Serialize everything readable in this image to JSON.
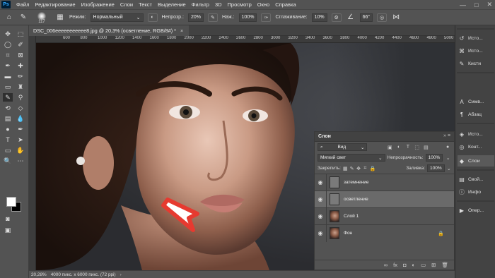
{
  "app": {
    "logo": "Ps"
  },
  "menu": [
    "Файл",
    "Редактирование",
    "Изображение",
    "Слои",
    "Текст",
    "Выделение",
    "Фильтр",
    "3D",
    "Просмотр",
    "Окно",
    "Справка"
  ],
  "window_controls": {
    "minimize": "—",
    "restore": "□",
    "close": "✕"
  },
  "options": {
    "brush_size": "117",
    "mode_label": "Режим:",
    "mode_value": "Нормальный",
    "opacity_label": "Непрозр.:",
    "opacity_value": "20%",
    "pressure_label": "Наж.:",
    "pressure_value": "100%",
    "smoothing_label": "Сглаживание:",
    "smoothing_value": "10%",
    "angle_value": "66°"
  },
  "document": {
    "tab_title": "DSC_006eeeeeeeeeee8.jpg @ 20,3% (осветление, RGB/8#) *",
    "close": "×",
    "ruler_ticks": [
      "600",
      "800",
      "1000",
      "1200",
      "1400",
      "1600",
      "1800",
      "2000",
      "2200",
      "2400",
      "2600",
      "2800",
      "3000",
      "3200",
      "3400",
      "3600",
      "3800",
      "4000",
      "4200",
      "4400",
      "4600",
      "4800",
      "5000",
      "5200"
    ]
  },
  "status": {
    "zoom": "20,28%",
    "info": "4000 пикс. x 6000 пикс. (72 ppi)",
    "arrow": "›"
  },
  "layers_panel": {
    "title": "Слои",
    "filter_kind": "Вид",
    "blend_mode": "Мягкий свет",
    "opacity_label": "Непрозрачность:",
    "opacity_value": "100%",
    "lock_label": "Закрепить:",
    "fill_label": "Заливка:",
    "fill_value": "100%",
    "layers": [
      {
        "name": "затемнение",
        "thumb": "gray",
        "selected": false,
        "locked": false
      },
      {
        "name": "осветление",
        "thumb": "gray",
        "selected": true,
        "locked": false
      },
      {
        "name": "Слой 1",
        "thumb": "face",
        "selected": false,
        "locked": false
      },
      {
        "name": "Фон",
        "thumb": "face",
        "selected": false,
        "locked": true
      }
    ]
  },
  "side_panels": [
    {
      "label": "Исто...",
      "icon": "history-icon"
    },
    {
      "label": "Исто...",
      "icon": "history-brush-icon"
    },
    {
      "label": "Кисти",
      "icon": "brush-icon"
    },
    {
      "label": "Симв...",
      "icon": "character-icon"
    },
    {
      "label": "Абзац",
      "icon": "paragraph-icon"
    },
    {
      "label": "Исто...",
      "icon": "source-icon"
    },
    {
      "label": "Конт...",
      "icon": "channels-icon"
    },
    {
      "label": "Слои",
      "icon": "layers-icon"
    },
    {
      "label": "Свой...",
      "icon": "properties-icon"
    },
    {
      "label": "Инфо",
      "icon": "info-icon"
    },
    {
      "label": "Опер...",
      "icon": "actions-icon"
    }
  ]
}
